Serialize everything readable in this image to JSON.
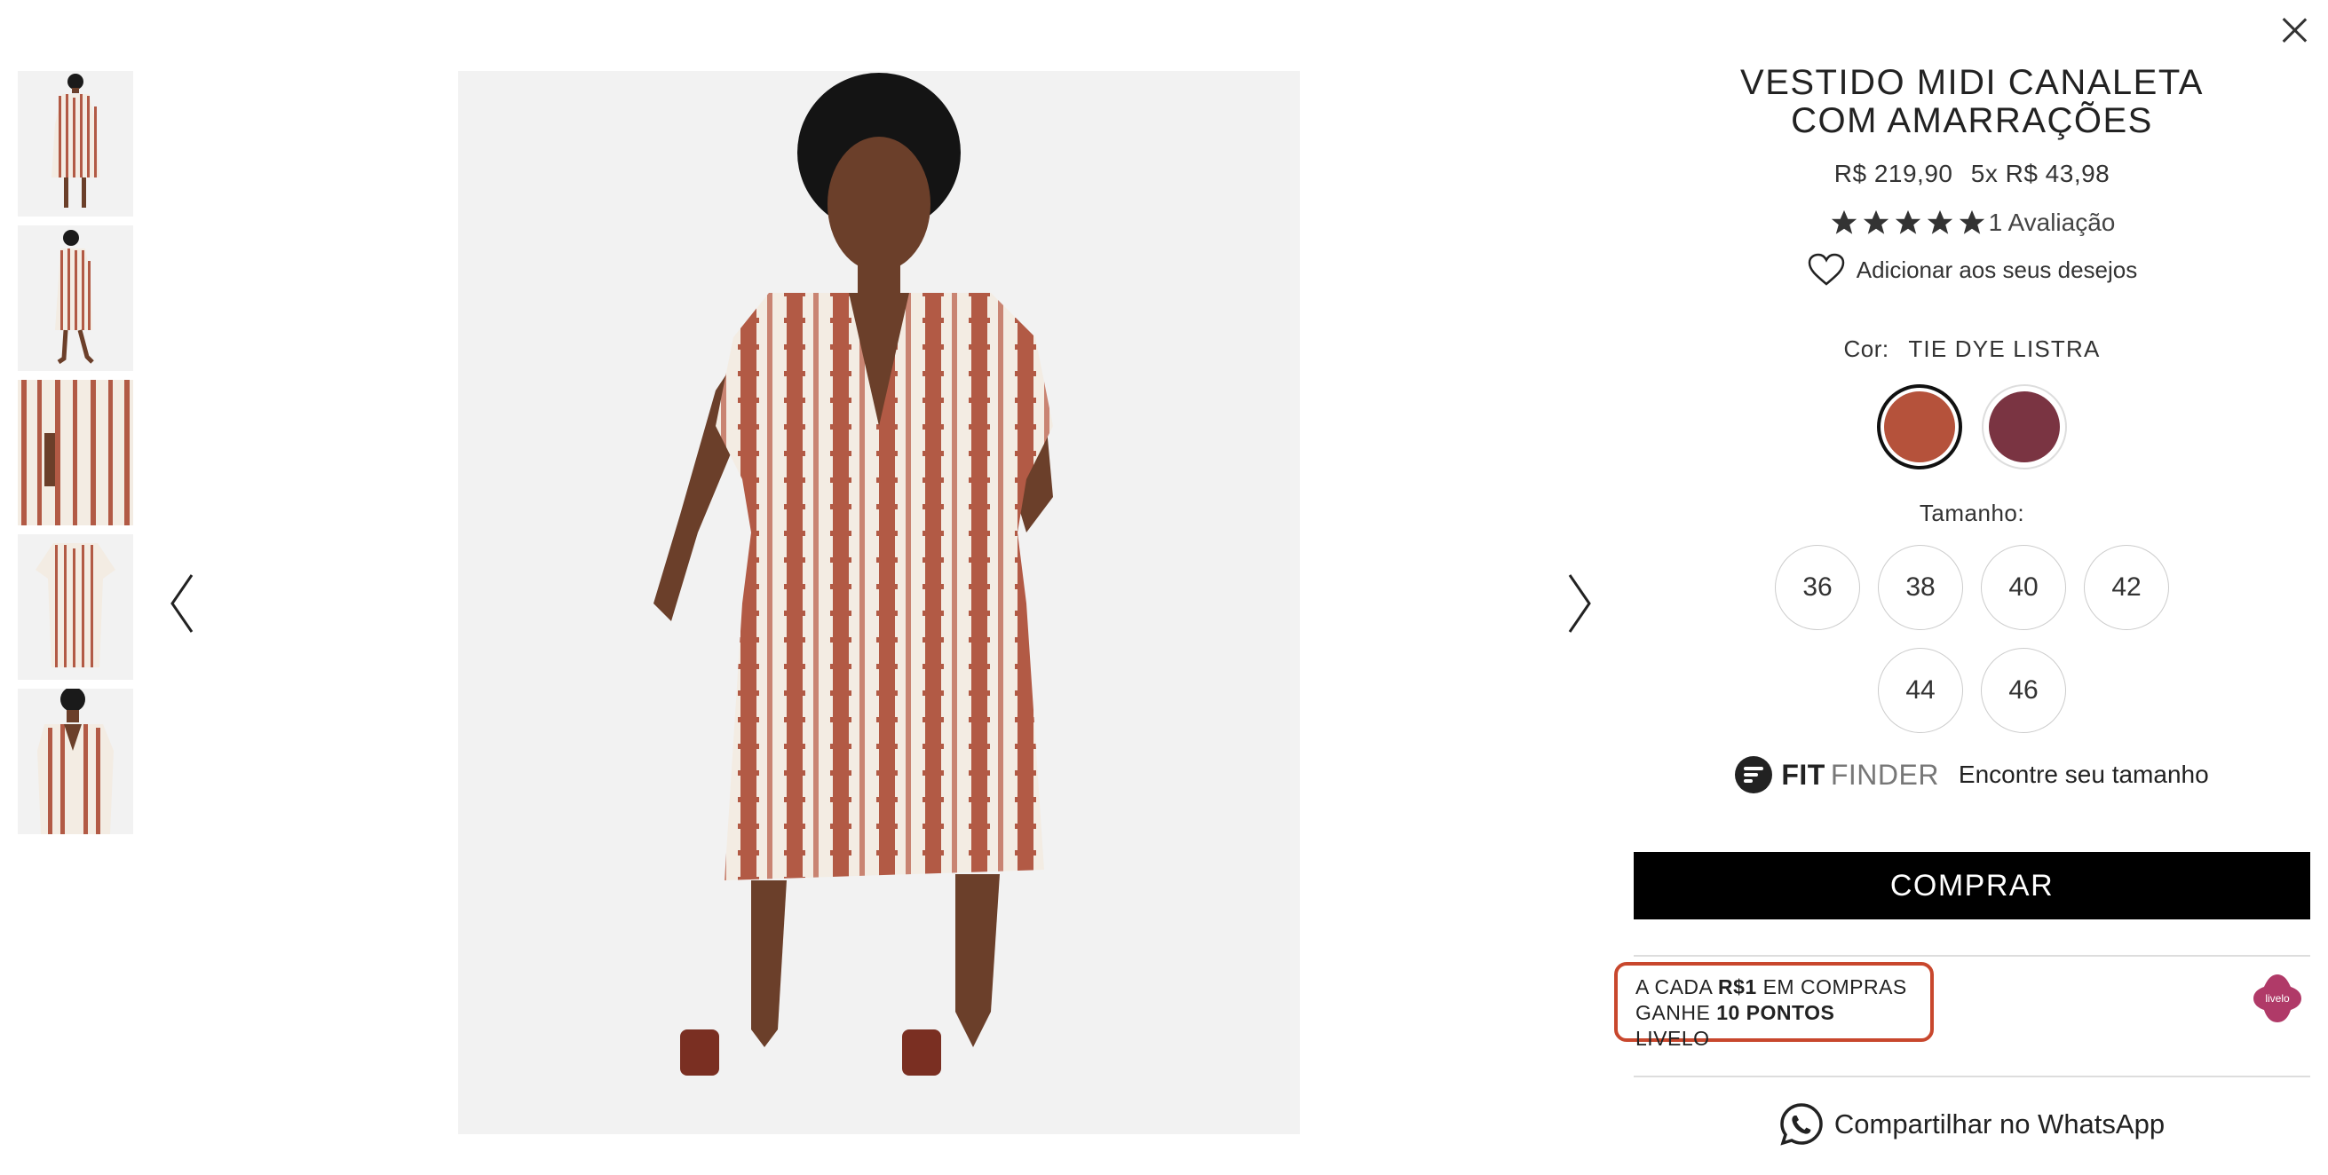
{
  "product": {
    "title": "VESTIDO MIDI CANALETA COM AMARRAÇÕES",
    "price": "R$ 219,90",
    "installments": "5x R$ 43,98",
    "rating": 5,
    "reviews": "1 Avaliação",
    "wishlist_label": "Adicionar aos seus desejos"
  },
  "color": {
    "label": "Cor:",
    "selected": "TIE DYE LISTRA",
    "swatches": [
      {
        "name": "TIE DYE LISTRA",
        "hex": "#b5523b"
      },
      {
        "name": "vinho",
        "hex": "#7a3442"
      }
    ]
  },
  "size": {
    "label": "Tamanho:",
    "options": [
      "36",
      "38",
      "40",
      "42",
      "44",
      "46"
    ]
  },
  "fit_finder": {
    "brand_bold": "FIT",
    "brand_light": "FINDER",
    "link": "Encontre seu tamanho"
  },
  "buy_label": "COMPRAR",
  "livelo": {
    "line1_pre": "A CADA",
    "line1_bold": "R$1",
    "line1_post": "EM COMPRAS",
    "line2_pre": "GANHE",
    "line2_bold": "10 PONTOS",
    "line2_post": "LIVELO",
    "logo_text": "livelo",
    "color": "#c8472d"
  },
  "share_label": "Compartilhar no WhatsApp",
  "gallery": {
    "thumbnail_count": 5,
    "dress_colors": {
      "stripe": "#b25a45",
      "base": "#f3ece3",
      "background": "#f2f2f2"
    }
  }
}
